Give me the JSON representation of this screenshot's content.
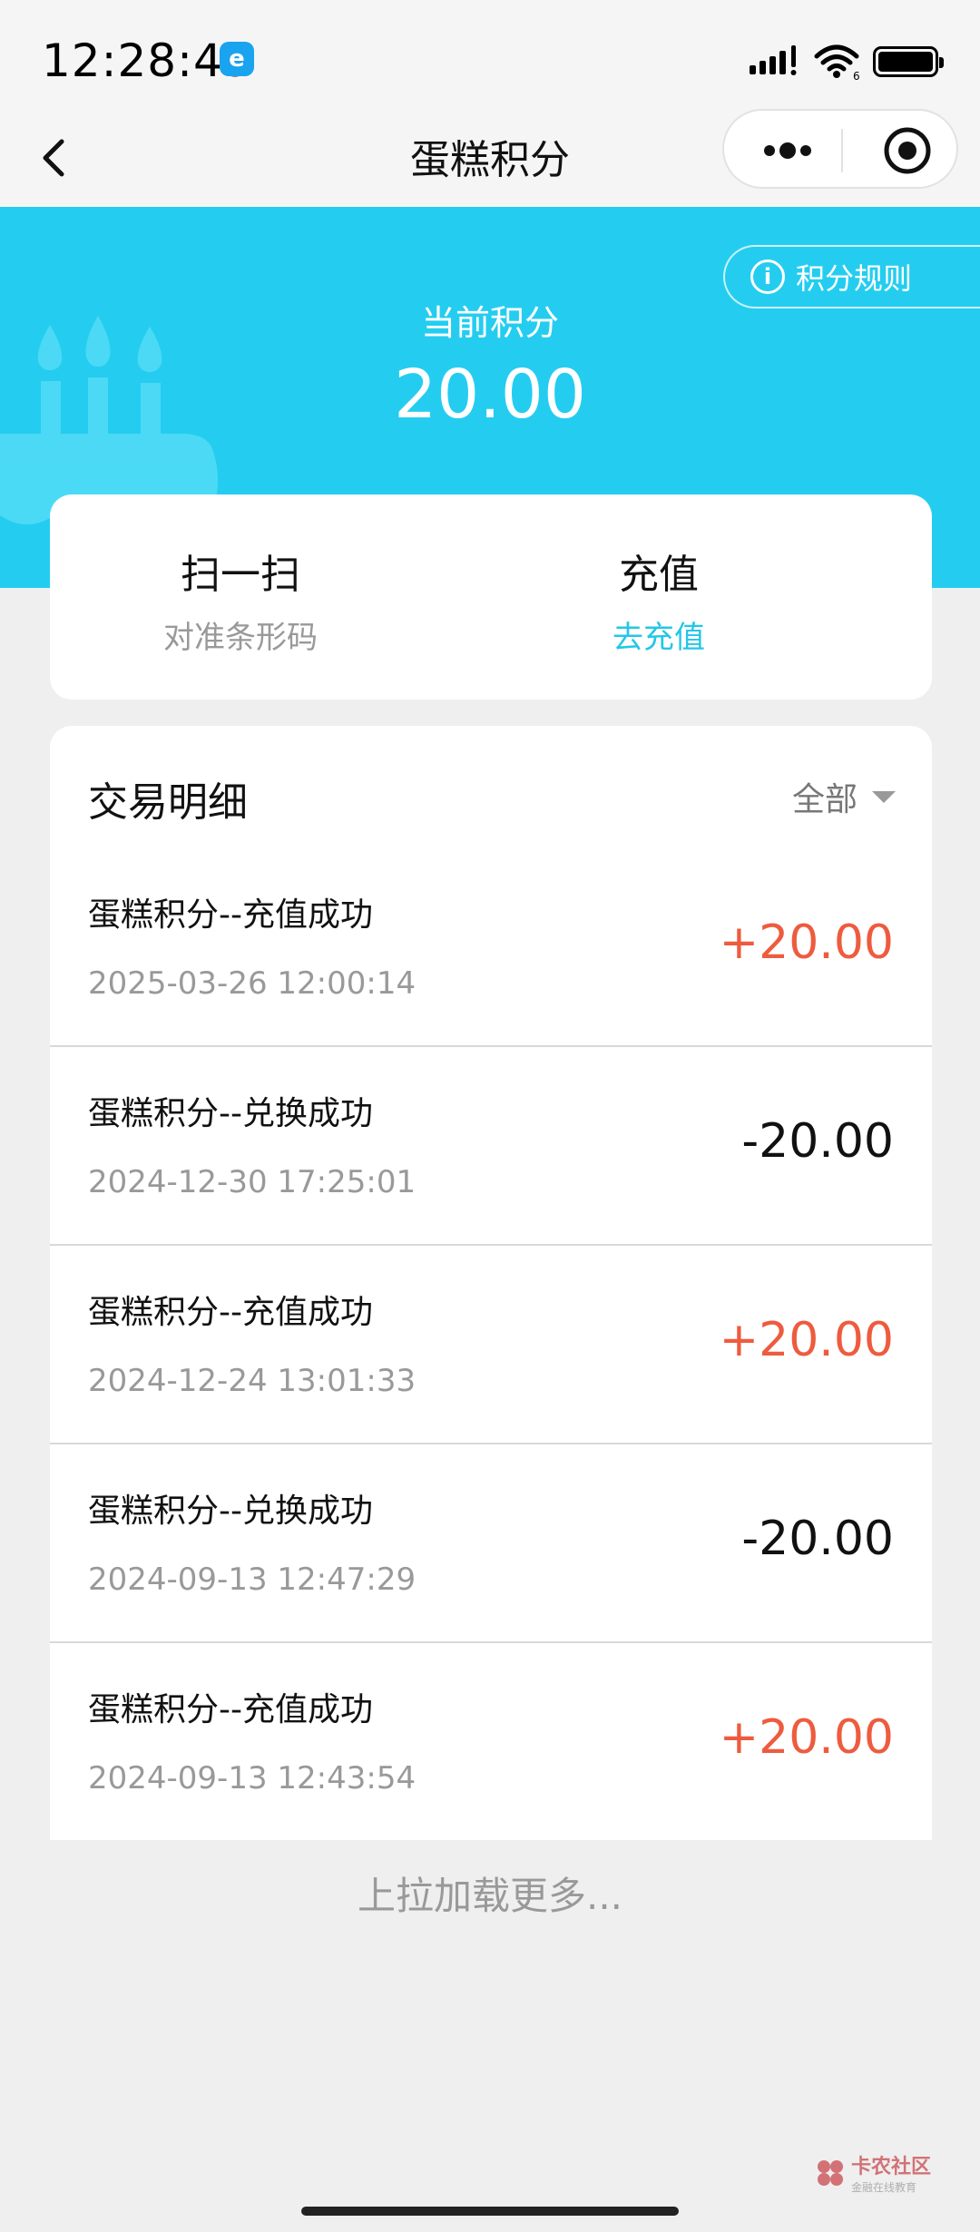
{
  "status_bar": {
    "time": "12:28:49",
    "mini_app_badge": "e",
    "battery_level": 1.0,
    "icons": [
      "signal-icon",
      "wifi-icon",
      "battery-icon"
    ]
  },
  "nav": {
    "title": "蛋糕积分",
    "icons": [
      "back-icon",
      "more-icon",
      "close-icon"
    ]
  },
  "banner": {
    "rules_label": "积分规则",
    "points_label": "当前积分",
    "points_value": "20.00",
    "background_color": "#24cdf0"
  },
  "actions": {
    "scan_title": "扫一扫",
    "scan_sub": "对准条形码",
    "recharge_title": "充值",
    "recharge_sub": "去充值"
  },
  "transactions": {
    "title": "交易明细",
    "filter": "全部",
    "items": [
      {
        "name": "蛋糕积分--充值成功",
        "time": "2025-03-26 12:00:14",
        "amount": "+20.00",
        "type": "pos"
      },
      {
        "name": "蛋糕积分--兑换成功",
        "time": "2024-12-30 17:25:01",
        "amount": "-20.00",
        "type": "neg"
      },
      {
        "name": "蛋糕积分--充值成功",
        "time": "2024-12-24 13:01:33",
        "amount": "+20.00",
        "type": "pos"
      },
      {
        "name": "蛋糕积分--兑换成功",
        "time": "2024-09-13 12:47:29",
        "amount": "-20.00",
        "type": "neg"
      },
      {
        "name": "蛋糕积分--充值成功",
        "time": "2024-09-13 12:43:54",
        "amount": "+20.00",
        "type": "pos"
      }
    ]
  },
  "load_more": "上拉加载更多...",
  "watermark": {
    "main": "卡农社区",
    "sub": "金融在线教育"
  },
  "colors": {
    "accent": "#24cdf0",
    "positive": "#ee5b3e",
    "link": "#24c6e8"
  }
}
